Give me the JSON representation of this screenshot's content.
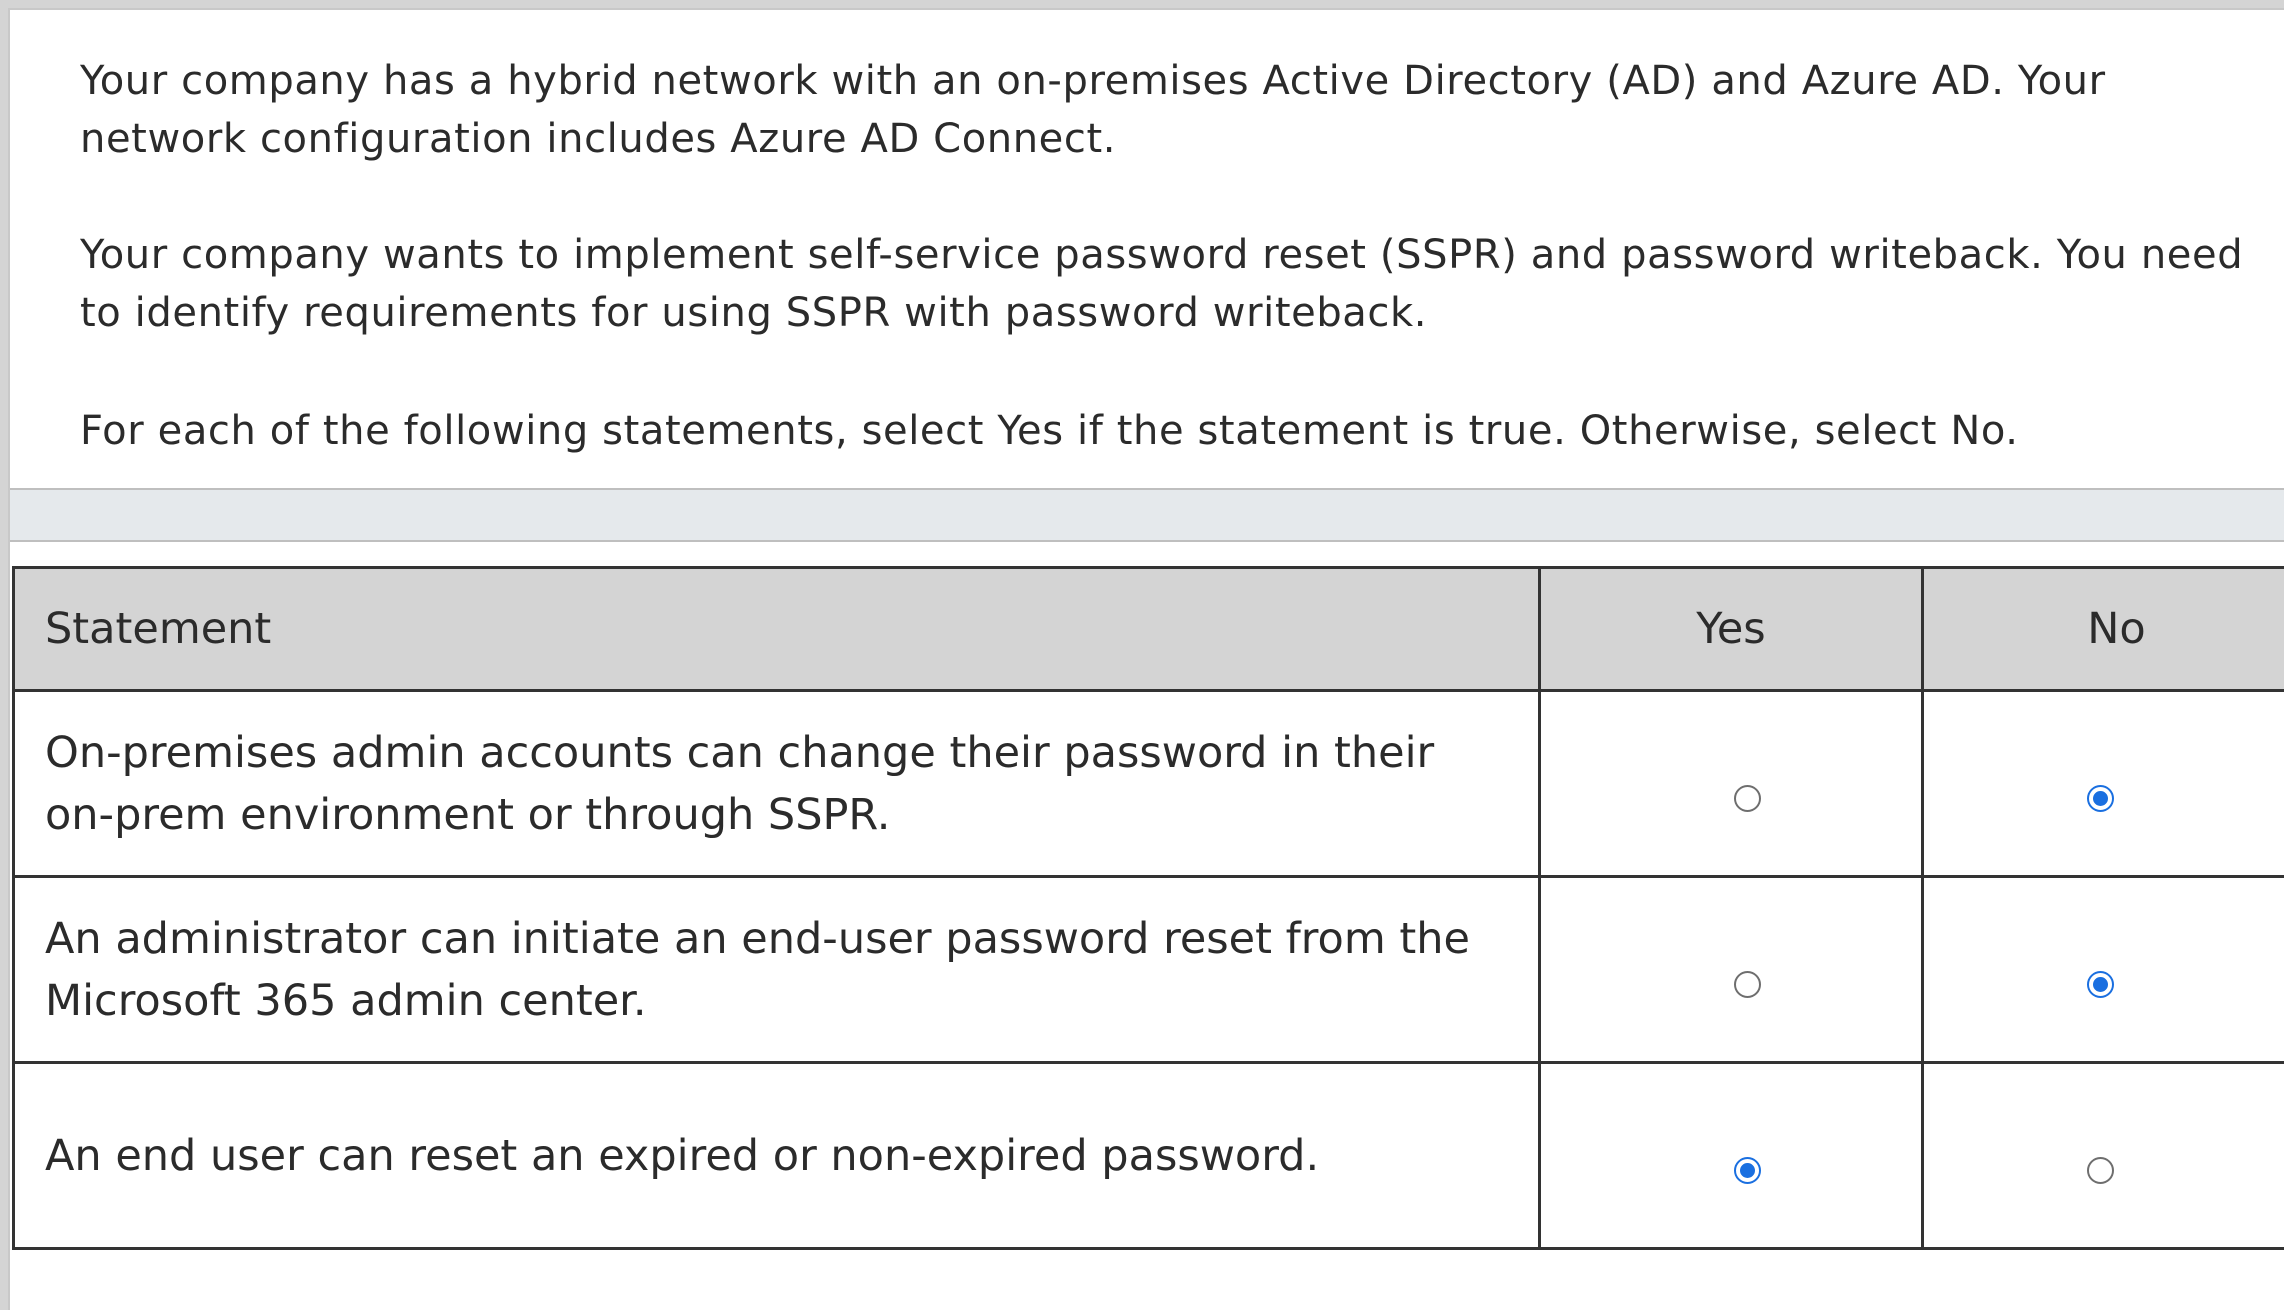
{
  "question": {
    "paragraphs": [
      "Your company has a hybrid network with an on-premises Active Directory (AD) and Azure AD. Your network configuration includes Azure AD Connect.",
      "Your company wants to implement self-service password reset (SSPR) and password writeback. You need to identify requirements for using SSPR with password writeback.",
      "For each of the following statements, select Yes if the statement is true. Otherwise, select No."
    ]
  },
  "table": {
    "headers": {
      "statement": "Statement",
      "yes": "Yes",
      "no": "No"
    },
    "rows": [
      {
        "statement": "On-premises admin accounts can change their password in their on-prem environment or through SSPR.",
        "selected": "No"
      },
      {
        "statement": "An administrator can initiate an end-user password reset from the Microsoft 365 admin center.",
        "selected": "No"
      },
      {
        "statement": "An end user can reset an expired or non-expired password.",
        "selected": "Yes"
      }
    ]
  },
  "colors": {
    "radio_selected": "#1a6fe0",
    "header_background": "#d4d4d4",
    "band_background": "#e5e9ec"
  }
}
